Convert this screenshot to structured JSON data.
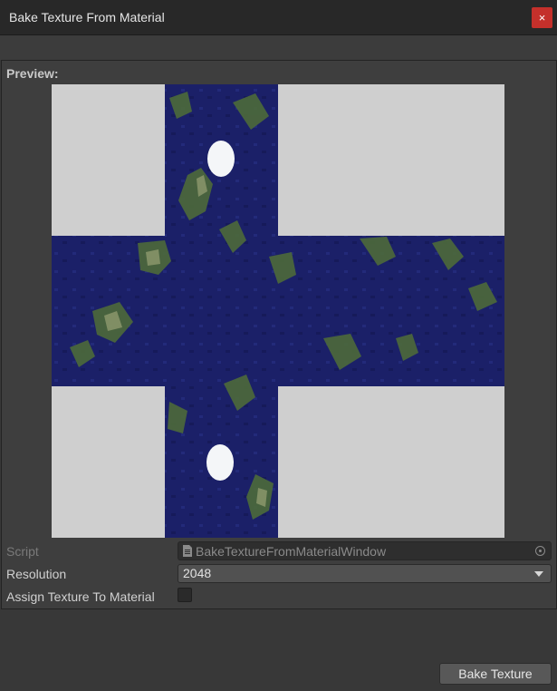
{
  "window": {
    "title": "Bake Texture From Material",
    "close_glyph": "×"
  },
  "preview": {
    "label": "Preview:",
    "image_description_icon": "cubemap-texture-preview"
  },
  "properties": {
    "script": {
      "label": "Script",
      "value": "BakeTextureFromMaterialWindow",
      "icon": "script-file-icon"
    },
    "resolution": {
      "label": "Resolution",
      "value": "2048"
    },
    "assign_texture": {
      "label": "Assign Texture To Material",
      "checked": false
    }
  },
  "actions": {
    "bake_label": "Bake Texture"
  },
  "colors": {
    "close_button": "#c4302b",
    "ocean": "#1a1f66",
    "preview_background": "#cfcfcf"
  }
}
